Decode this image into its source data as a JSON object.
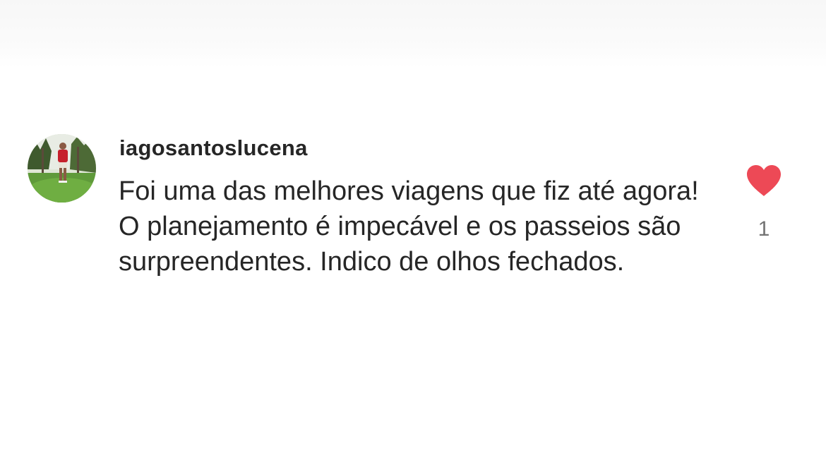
{
  "comment": {
    "username": "iagosantoslucena",
    "text": "Foi uma das melhores viagens que fiz até agora! O planejamento é impecável e os passeios são surpreendentes. Indico de olhos fechados.",
    "like_count": "1",
    "liked": true
  },
  "icons": {
    "like": "heart-icon",
    "avatar": "avatar"
  },
  "colors": {
    "heart": "#ed4956",
    "text": "#262626",
    "count": "#737373"
  }
}
